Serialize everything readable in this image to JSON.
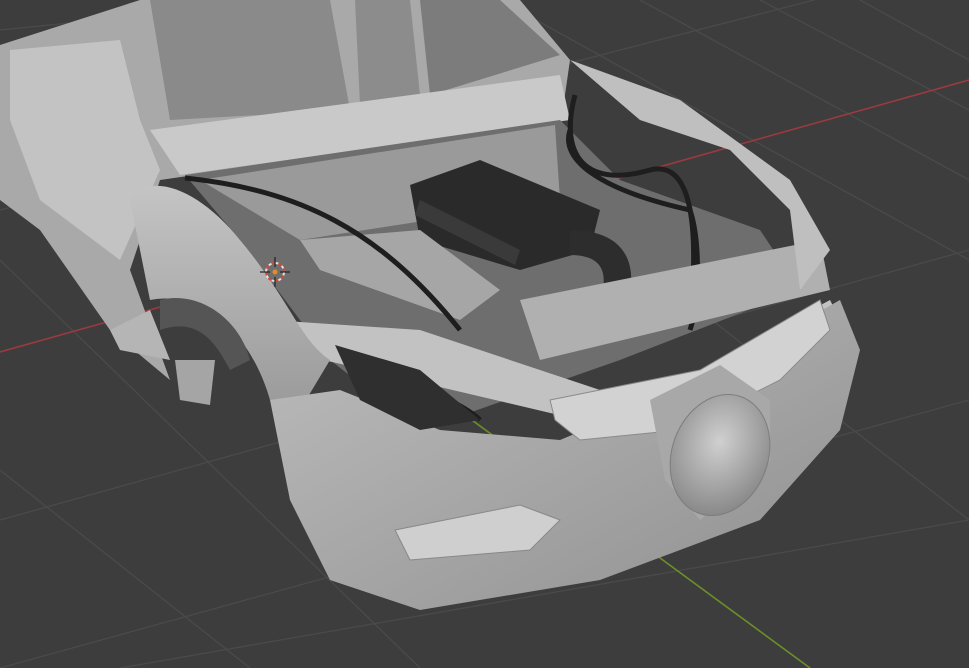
{
  "viewport": {
    "mode": "3d-viewport",
    "background_color": "#3d3d3d",
    "grid_color": "#4a4a4a",
    "x_axis_color": "#9b3a3f",
    "y_axis_color": "#6a8f2a",
    "model_color": "#b9b9b9",
    "model_shadow_color": "#8e8e8e",
    "engine_color": "#2a2a2a"
  },
  "icons": {
    "cursor": "3d-cursor-icon"
  }
}
